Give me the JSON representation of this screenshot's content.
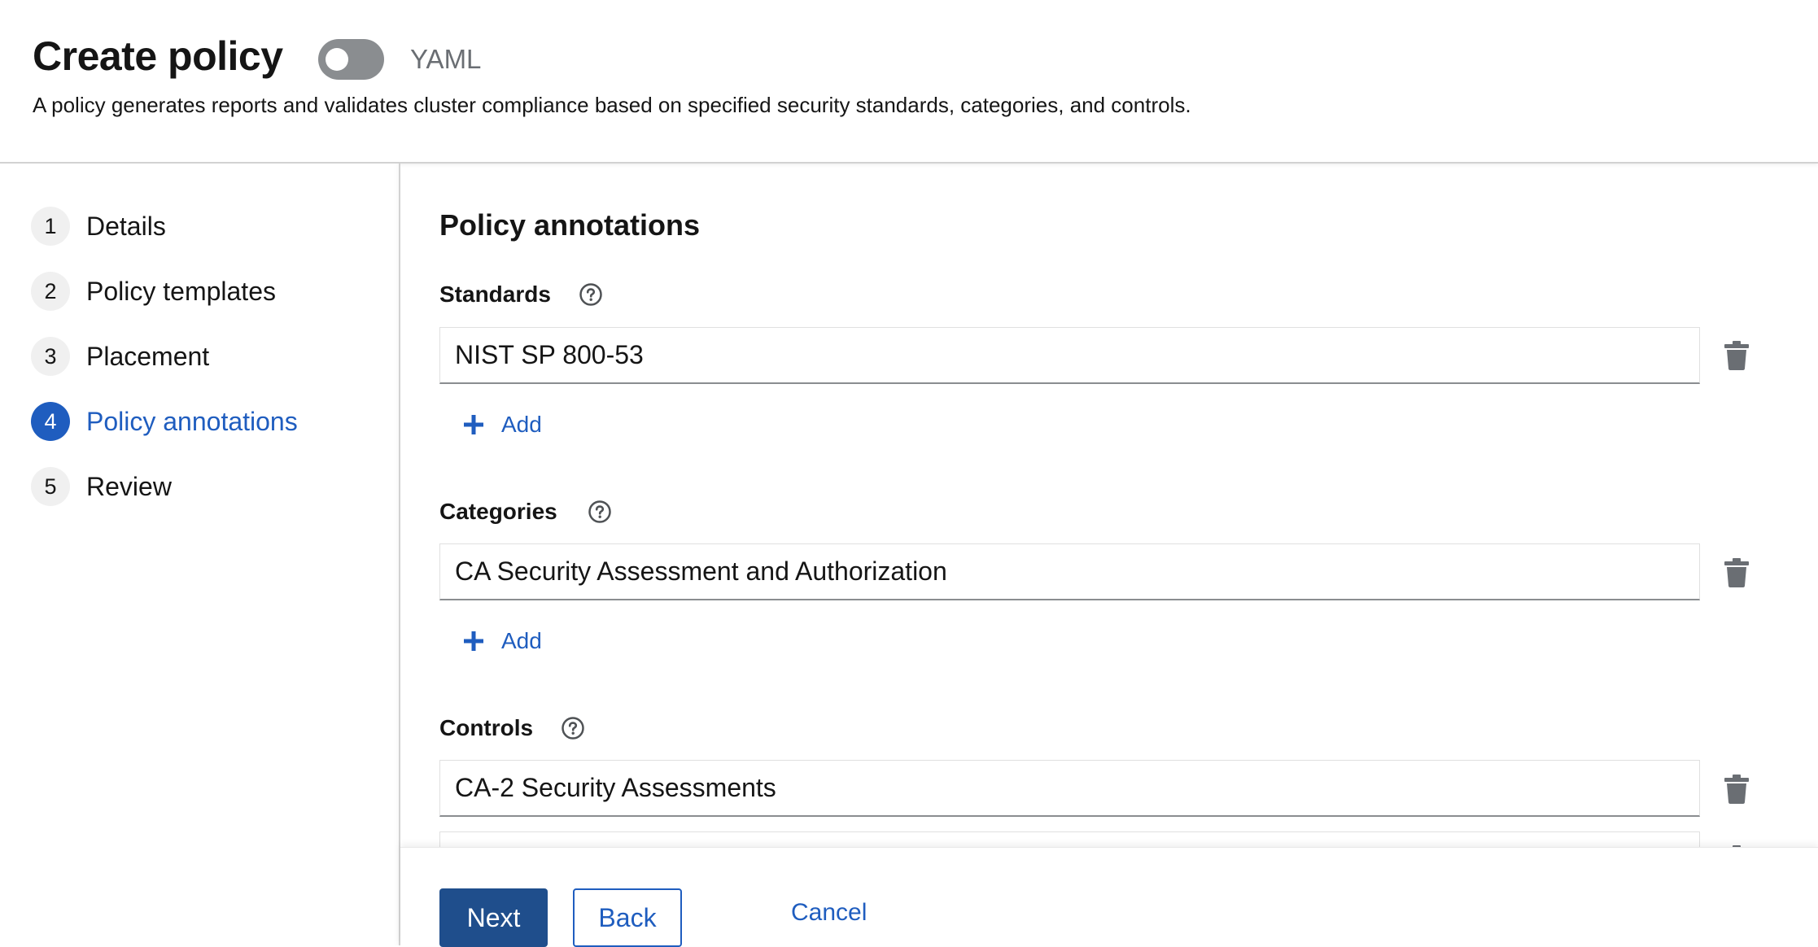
{
  "header": {
    "title": "Create policy",
    "yaml_toggle_label": "YAML",
    "description": "A policy generates reports and validates cluster compliance based on specified security standards, categories, and controls."
  },
  "wizard_nav": {
    "items": [
      {
        "number": "1",
        "label": "Details"
      },
      {
        "number": "2",
        "label": "Policy templates"
      },
      {
        "number": "3",
        "label": "Placement"
      },
      {
        "number": "4",
        "label": "Policy annotations"
      },
      {
        "number": "5",
        "label": "Review"
      }
    ],
    "active_index": 3
  },
  "main": {
    "section_title": "Policy annotations",
    "standards": {
      "label": "Standards",
      "value": "NIST SP 800-53",
      "add_label": "Add"
    },
    "categories": {
      "label": "Categories",
      "value": "CA Security Assessment and Authorization",
      "add_label": "Add"
    },
    "controls": {
      "label": "Controls",
      "value": "CA-2 Security Assessments"
    }
  },
  "footer": {
    "next_label": "Next",
    "back_label": "Back",
    "cancel_label": "Cancel"
  },
  "colors": {
    "accent": "#1f5dbf",
    "primary_button": "#1f4e8c",
    "toggle_off": "#8a8d90"
  },
  "icons": [
    "help-circle-icon",
    "trash-icon",
    "plus-icon"
  ]
}
